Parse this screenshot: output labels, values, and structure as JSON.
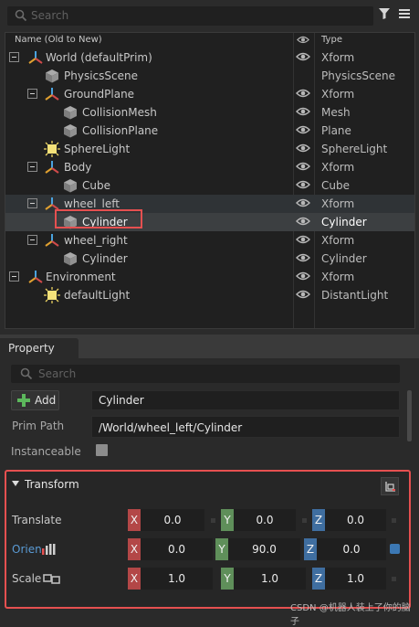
{
  "stage": {
    "search_placeholder": "Search",
    "columns": {
      "name": "Name (Old to New)",
      "type": "Type"
    },
    "rows": [
      {
        "name": "World (defaultPrim)",
        "type": "Xform"
      },
      {
        "name": "PhysicsScene",
        "type": "PhysicsScene"
      },
      {
        "name": "GroundPlane",
        "type": "Xform"
      },
      {
        "name": "CollisionMesh",
        "type": "Mesh"
      },
      {
        "name": "CollisionPlane",
        "type": "Plane"
      },
      {
        "name": "SphereLight",
        "type": "SphereLight"
      },
      {
        "name": "Body",
        "type": "Xform"
      },
      {
        "name": "Cube",
        "type": "Cube"
      },
      {
        "name": "wheel_left",
        "type": "Xform"
      },
      {
        "name": "Cylinder",
        "type": "Cylinder"
      },
      {
        "name": "wheel_right",
        "type": "Xform"
      },
      {
        "name": "Cylinder",
        "type": "Cylinder"
      },
      {
        "name": "Environment",
        "type": "Xform"
      },
      {
        "name": "defaultLight",
        "type": "DistantLight"
      }
    ]
  },
  "property": {
    "tab_label": "Property",
    "search_placeholder": "Search",
    "add_label": "Add",
    "name_value": "Cylinder",
    "prim_path_label": "Prim Path",
    "prim_path_value": "/World/wheel_left/Cylinder",
    "instanceable_label": "Instanceable",
    "transform": {
      "title": "Transform",
      "translate": {
        "label": "Translate",
        "x": "0.0",
        "y": "0.0",
        "z": "0.0"
      },
      "orient": {
        "label": "Orien",
        "x": "0.0",
        "y": "90.0",
        "z": "0.0"
      },
      "scale": {
        "label": "Scale",
        "x": "1.0",
        "y": "1.0",
        "z": "1.0"
      },
      "axis_labels": {
        "x": "X",
        "y": "Y",
        "z": "Z"
      }
    }
  },
  "watermark": "CSDN @机器人装上了你的脑子",
  "colors": {
    "highlight": "#e55050",
    "axis_x": "#b34747",
    "axis_y": "#5f8f5a",
    "axis_z": "#3f6ea0"
  }
}
